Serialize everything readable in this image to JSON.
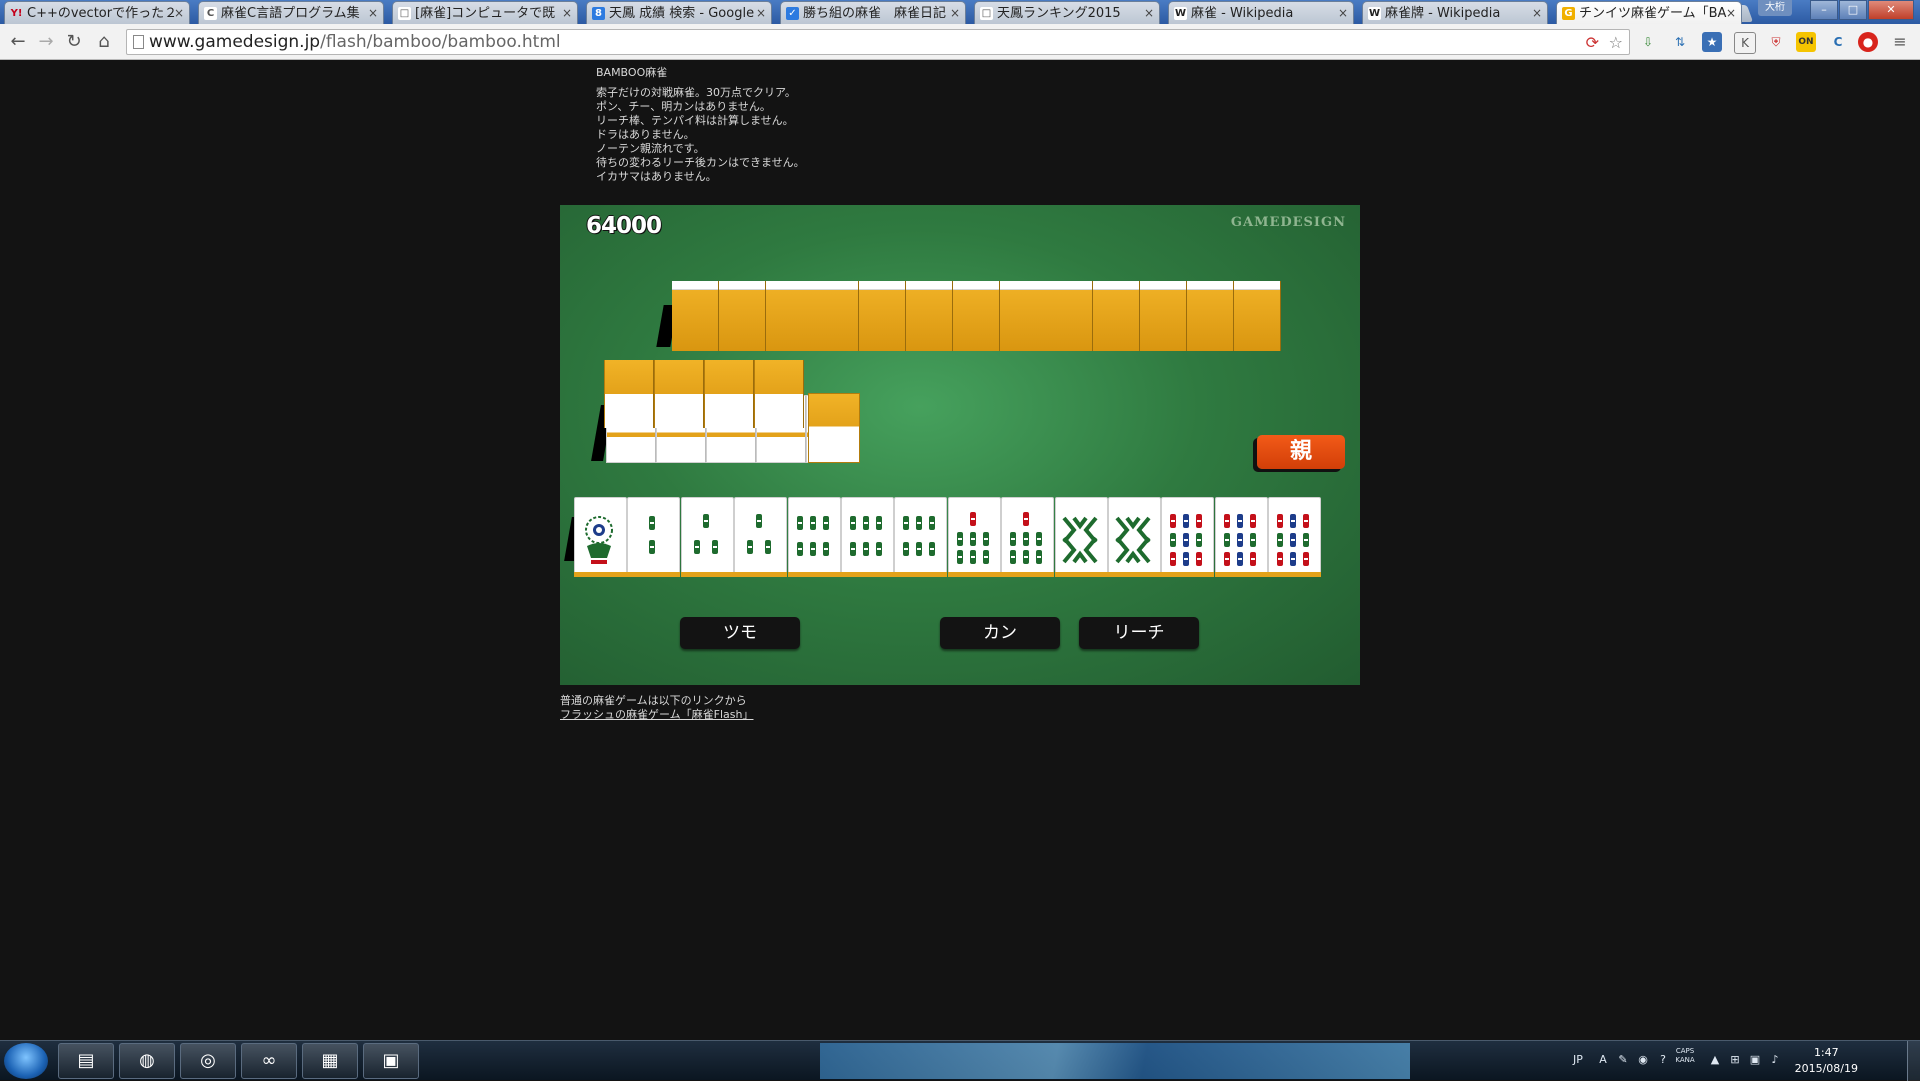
{
  "tabs": [
    {
      "label": "C++のvectorで作った２",
      "favicon": "Y!"
    },
    {
      "label": "麻雀C言語プログラム集",
      "favicon": "C"
    },
    {
      "label": "[麻雀]コンピュータで既",
      "favicon": "□"
    },
    {
      "label": "天鳳 成績 検索 - Google",
      "favicon": "8"
    },
    {
      "label": "勝ち組の麻雀　麻雀日記",
      "favicon": "✓"
    },
    {
      "label": "天鳳ランキング2015",
      "favicon": "□"
    },
    {
      "label": "麻雀 - Wikipedia",
      "favicon": "W"
    },
    {
      "label": "麻雀牌 - Wikipedia",
      "favicon": "W"
    },
    {
      "label": "チンイツ麻雀ゲーム「BA",
      "favicon": "G"
    }
  ],
  "active_tab_index": 8,
  "window_user_label": "大桁",
  "address_bar": {
    "host": "www.gamedesign.jp",
    "path": "/flash/bamboo/bamboo.html"
  },
  "page": {
    "title": "BAMBOO麻雀",
    "rules": [
      "索子だけの対戦麻雀。30万点でクリア。",
      "ポン、チー、明カンはありません。",
      "リーチ棒、テンパイ料は計算しません。",
      "ドラはありません。",
      "ノーテン親流れです。",
      "待ちの変わるリーチ後カンはできません。",
      "イカサマはありません。"
    ],
    "footer_text": "普通の麻雀ゲームは以下のリンクから",
    "footer_link": "フラッシュの麻雀ゲーム「麻雀Flash」"
  },
  "game": {
    "score": "64000",
    "brand": "GAMEDESIGN",
    "dealer_badge": "親",
    "opponent_hand_count": 13,
    "wall_top_row_count": 4,
    "wall_bottom_row_count": 5,
    "player_hand": [
      "1s",
      "2s",
      "3s",
      "3s",
      "6s",
      "6s",
      "6s",
      "7s",
      "7s",
      "8s",
      "8s",
      "9s",
      "9s",
      "9s"
    ],
    "buttons": {
      "tsumo": "ツモ",
      "kan": "カン",
      "riichi": "リーチ"
    }
  },
  "taskbar": {
    "apps": [
      "explorer-icon",
      "chrome-icon",
      "media-player-icon",
      "infinity-app-icon",
      "paint-app-icon",
      "window-app-icon"
    ],
    "clock_time": "1:47",
    "clock_date": "2015/08/19",
    "ime_label": "JP",
    "caps_label": "CAPS",
    "kana_label": "KANA"
  },
  "colors": {
    "table_green": "#2f7a40",
    "tile_back": "#e3a21a",
    "dealer_red": "#e04b10",
    "button_bg": "#131313"
  }
}
